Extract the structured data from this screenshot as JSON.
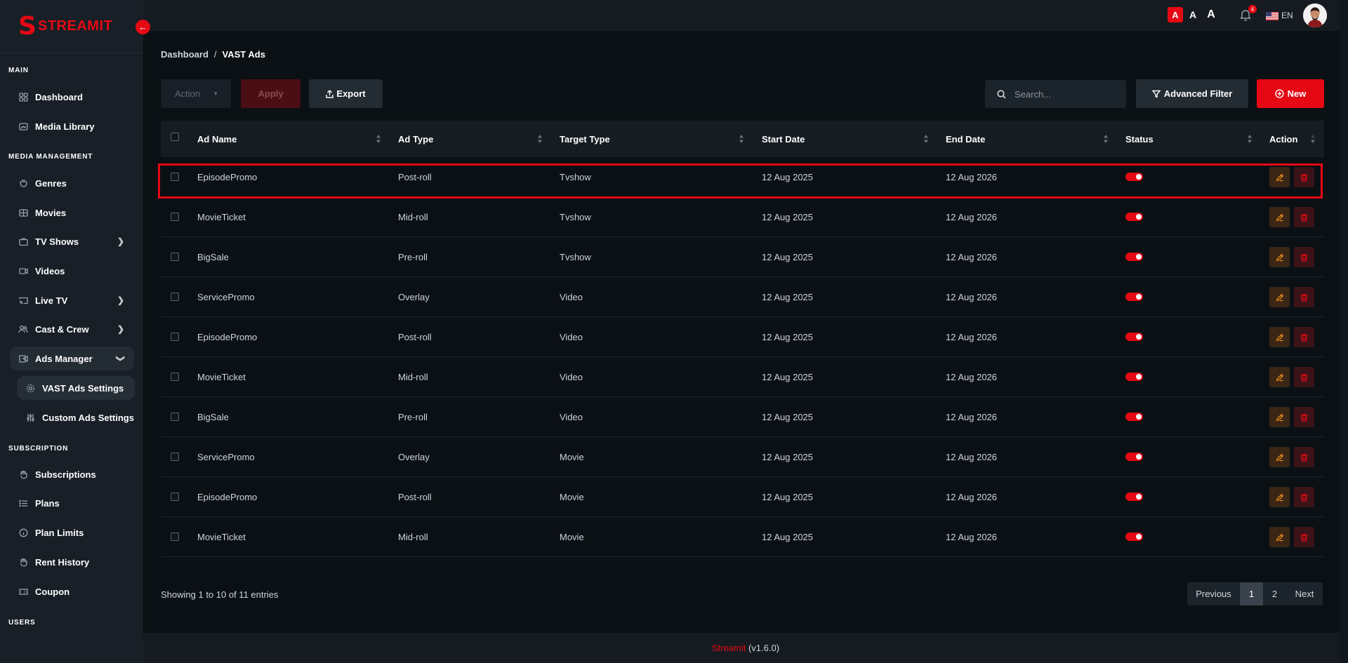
{
  "brand": {
    "name": "STREAMIT"
  },
  "sidebar": {
    "sections": [
      "MAIN",
      "MEDIA MANAGEMENT",
      "SUBSCRIPTION",
      "USERS"
    ],
    "items": {
      "dashboard": "Dashboard",
      "media_library": "Media Library",
      "genres": "Genres",
      "movies": "Movies",
      "tv_shows": "TV Shows",
      "videos": "Videos",
      "live_tv": "Live TV",
      "cast_crew": "Cast & Crew",
      "ads_manager": "Ads Manager",
      "vast_ads_settings": "VAST Ads Settings",
      "custom_ads_settings": "Custom Ads Settings",
      "subscriptions": "Subscriptions",
      "plans": "Plans",
      "plan_limits": "Plan Limits",
      "rent_history": "Rent History",
      "coupon": "Coupon"
    }
  },
  "topbar": {
    "font_size_labels": [
      "A",
      "A",
      "A"
    ],
    "notification_count": "4",
    "language": "EN"
  },
  "breadcrumb": {
    "root": "Dashboard",
    "separator": "/",
    "current": "VAST Ads"
  },
  "toolbar": {
    "action_label": "Action",
    "apply_label": "Apply",
    "export_label": "Export",
    "search_placeholder": "Search...",
    "advanced_filter_label": "Advanced Filter",
    "new_label": "New"
  },
  "table": {
    "columns": [
      "Ad Name",
      "Ad Type",
      "Target Type",
      "Start Date",
      "End Date",
      "Status",
      "Action"
    ],
    "rows": [
      {
        "name": "EpisodePromo",
        "type": "Post-roll",
        "target": "Tvshow",
        "start": "12 Aug 2025",
        "end": "12 Aug 2026",
        "status": true
      },
      {
        "name": "MovieTicket",
        "type": "Mid-roll",
        "target": "Tvshow",
        "start": "12 Aug 2025",
        "end": "12 Aug 2026",
        "status": true
      },
      {
        "name": "BigSale",
        "type": "Pre-roll",
        "target": "Tvshow",
        "start": "12 Aug 2025",
        "end": "12 Aug 2026",
        "status": true
      },
      {
        "name": "ServicePromo",
        "type": "Overlay",
        "target": "Video",
        "start": "12 Aug 2025",
        "end": "12 Aug 2026",
        "status": true
      },
      {
        "name": "EpisodePromo",
        "type": "Post-roll",
        "target": "Video",
        "start": "12 Aug 2025",
        "end": "12 Aug 2026",
        "status": true
      },
      {
        "name": "MovieTicket",
        "type": "Mid-roll",
        "target": "Video",
        "start": "12 Aug 2025",
        "end": "12 Aug 2026",
        "status": true
      },
      {
        "name": "BigSale",
        "type": "Pre-roll",
        "target": "Video",
        "start": "12 Aug 2025",
        "end": "12 Aug 2026",
        "status": true
      },
      {
        "name": "ServicePromo",
        "type": "Overlay",
        "target": "Movie",
        "start": "12 Aug 2025",
        "end": "12 Aug 2026",
        "status": true
      },
      {
        "name": "EpisodePromo",
        "type": "Post-roll",
        "target": "Movie",
        "start": "12 Aug 2025",
        "end": "12 Aug 2026",
        "status": true
      },
      {
        "name": "MovieTicket",
        "type": "Mid-roll",
        "target": "Movie",
        "start": "12 Aug 2025",
        "end": "12 Aug 2026",
        "status": true
      }
    ]
  },
  "entries_text": "Showing 1 to 10 of 11 entries",
  "pagination": {
    "previous": "Previous",
    "pages": [
      "1",
      "2"
    ],
    "current_page": "1",
    "next": "Next"
  },
  "footer": {
    "brand": "Streamit",
    "version": " (v1.6.0)"
  },
  "colors": {
    "accent": "#e50914",
    "background": "#0b1014",
    "sidebar": "#181f26",
    "edit": "#e8861a"
  }
}
